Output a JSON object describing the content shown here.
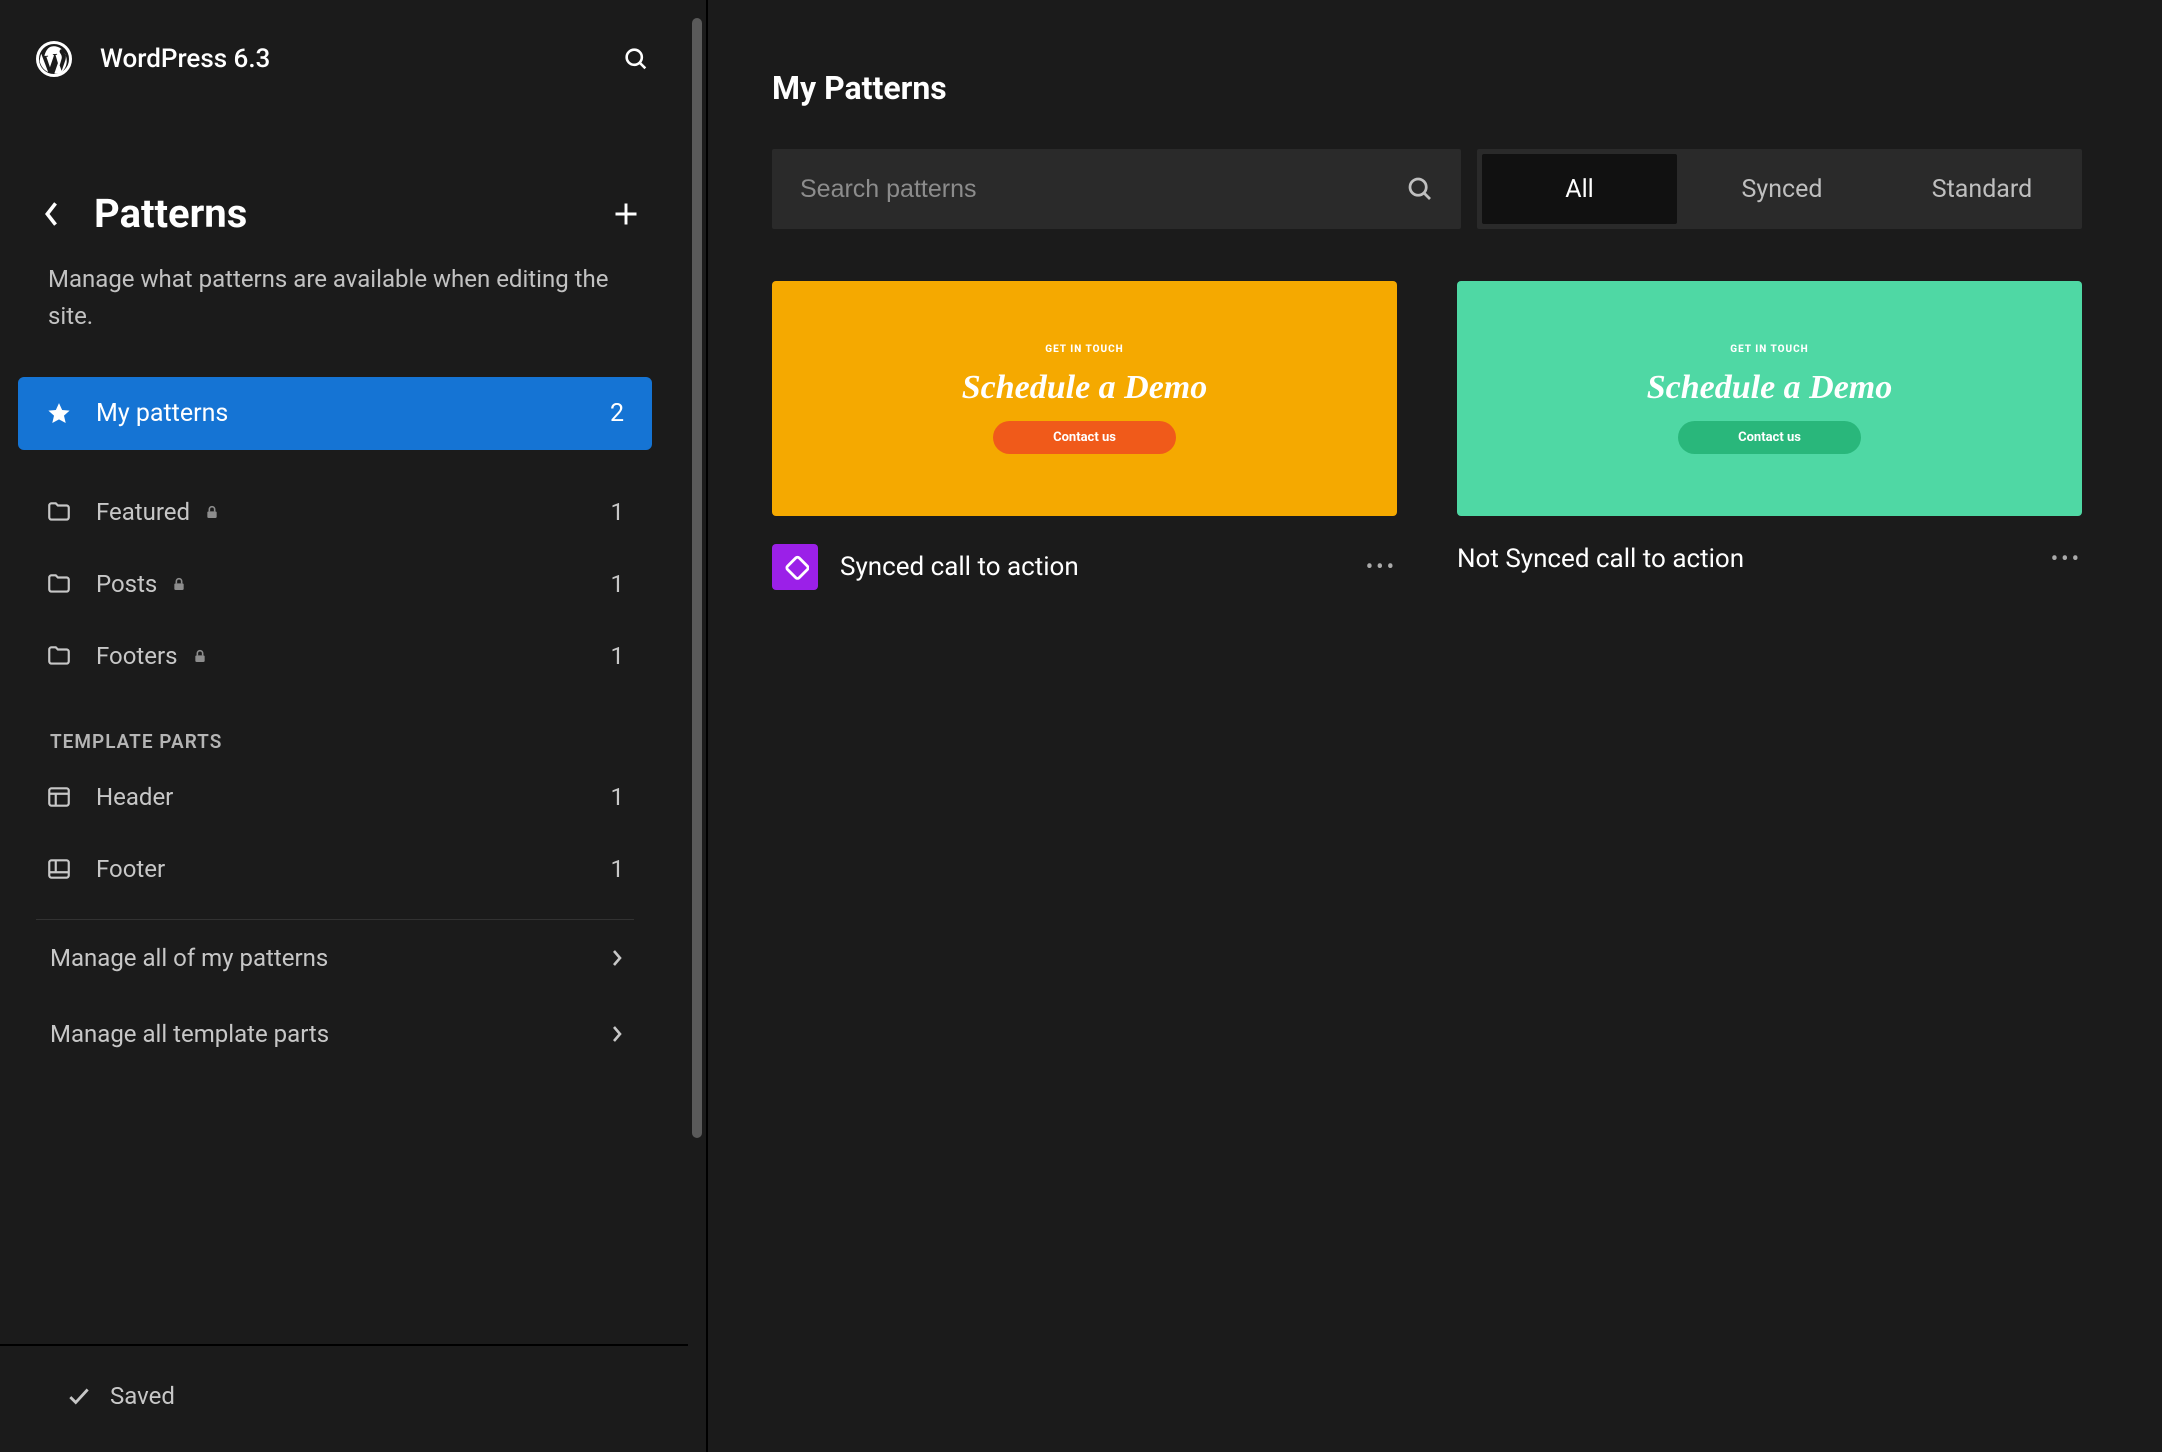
{
  "header": {
    "site_title": "WordPress 6.3"
  },
  "sidebar": {
    "title": "Patterns",
    "description": "Manage what patterns are available when editing the site.",
    "primary": {
      "label": "My patterns",
      "count": "2"
    },
    "categories": [
      {
        "label": "Featured",
        "count": "1",
        "locked": true
      },
      {
        "label": "Posts",
        "count": "1",
        "locked": true
      },
      {
        "label": "Footers",
        "count": "1",
        "locked": true
      }
    ],
    "template_parts_heading": "TEMPLATE PARTS",
    "template_parts": [
      {
        "label": "Header",
        "count": "1"
      },
      {
        "label": "Footer",
        "count": "1"
      }
    ],
    "links": {
      "manage_patterns": "Manage all of my patterns",
      "manage_template_parts": "Manage all template parts"
    },
    "saved_label": "Saved"
  },
  "content": {
    "title": "My Patterns",
    "search_placeholder": "Search patterns",
    "filter_tabs": {
      "all": "All",
      "synced": "Synced",
      "standard": "Standard"
    },
    "cards": [
      {
        "title": "Synced call to action",
        "synced": true,
        "preview": {
          "kicker": "GET IN TOUCH",
          "headline": "Schedule a Demo",
          "button": "Contact us",
          "bg": "#f5a900",
          "btn_bg": "#f05a1a"
        }
      },
      {
        "title": "Not Synced call to action",
        "synced": false,
        "preview": {
          "kicker": "GET IN TOUCH",
          "headline": "Schedule a Demo",
          "button": "Contact us",
          "bg": "#4fd8a4",
          "btn_bg": "#29b77b"
        }
      }
    ]
  }
}
